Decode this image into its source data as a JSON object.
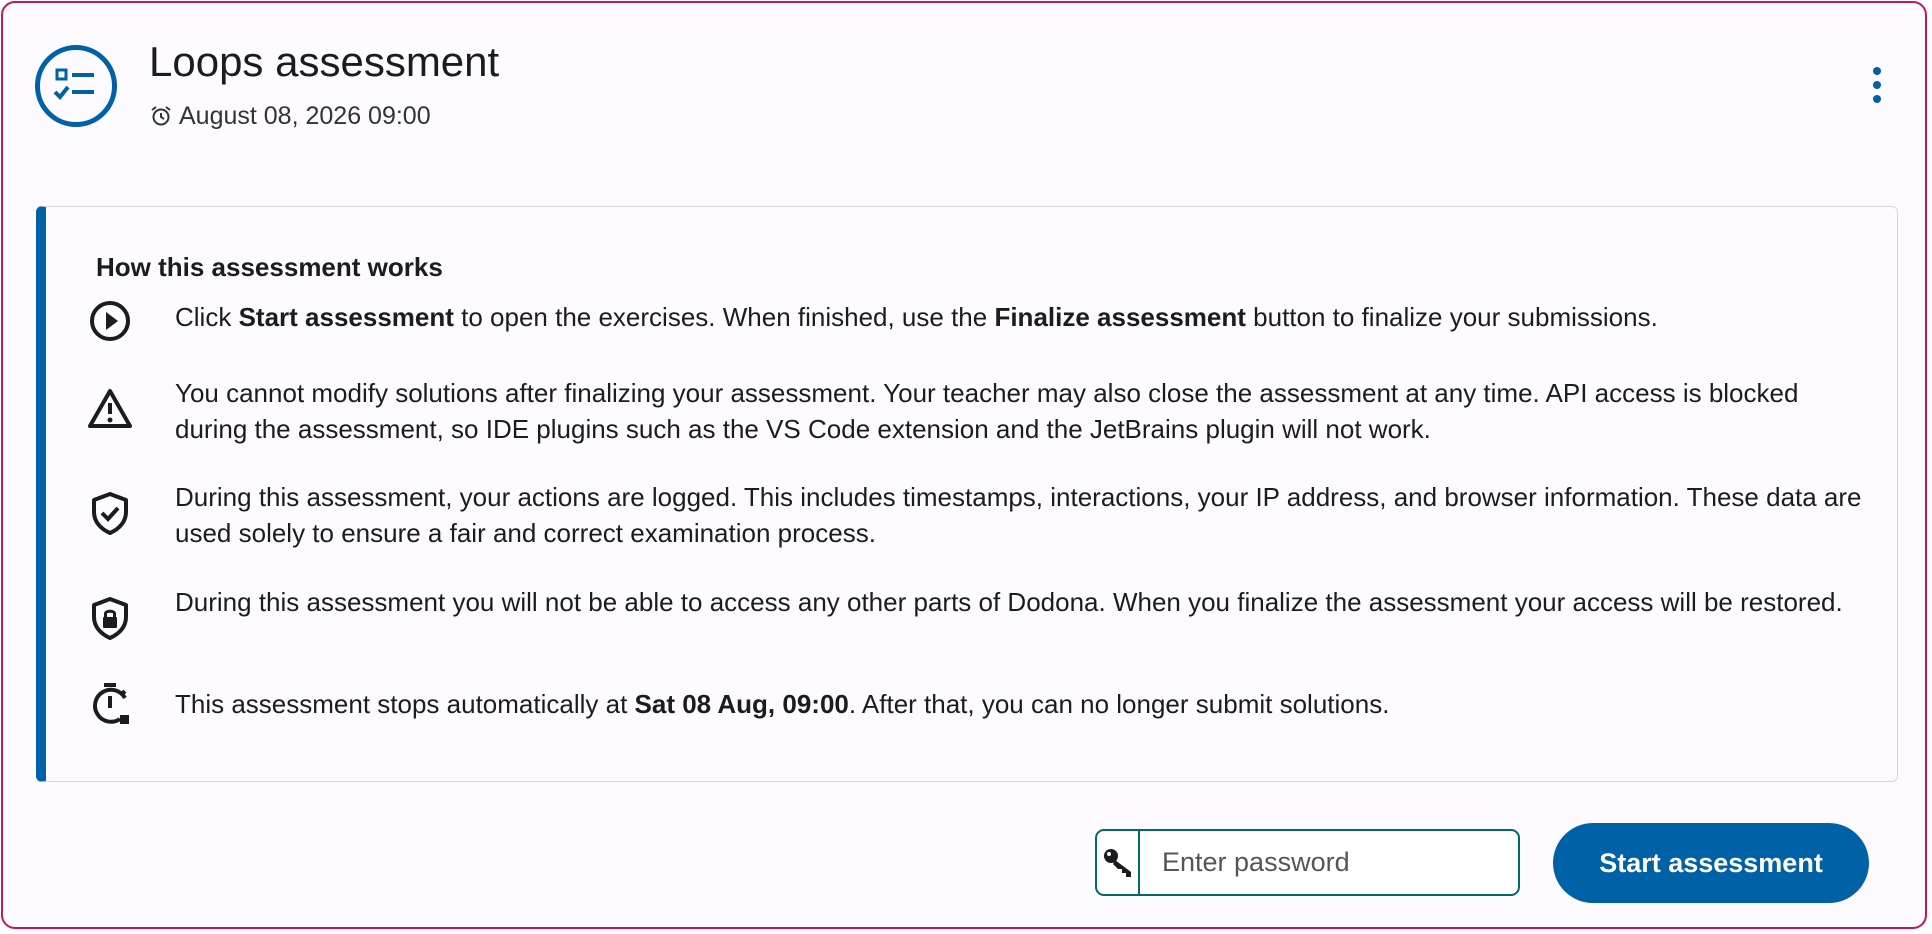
{
  "header": {
    "title": "Loops assessment",
    "deadline": "August 08, 2026 09:00",
    "icon": "checklist-icon"
  },
  "info": {
    "title": "How this assessment works",
    "rules": [
      {
        "icon": "play-circle-icon",
        "parts": [
          {
            "text": "Click ",
            "bold": false
          },
          {
            "text": "Start assessment",
            "bold": true
          },
          {
            "text": " to open the exercises. When finished, use the ",
            "bold": false
          },
          {
            "text": "Finalize assessment",
            "bold": true
          },
          {
            "text": " button to finalize your submissions.",
            "bold": false
          }
        ]
      },
      {
        "icon": "warning-icon",
        "parts": [
          {
            "text": "You cannot modify solutions after finalizing your assessment. Your teacher may also close the assessment at any time. API access is blocked during the assessment, so IDE plugins such as the VS Code extension and the JetBrains plugin will not work.",
            "bold": false
          }
        ]
      },
      {
        "icon": "shield-check-icon",
        "parts": [
          {
            "text": "During this assessment, your actions are logged. This includes timestamps, interactions, your IP address, and browser information. These data are used solely to ensure a fair and correct examination process.",
            "bold": false
          }
        ]
      },
      {
        "icon": "shield-lock-icon",
        "parts": [
          {
            "text": "During this assessment you will not be able to access any other parts of Dodona. When you finalize the assessment your access will be restored.",
            "bold": false
          }
        ]
      },
      {
        "icon": "timer-stop-icon",
        "parts": [
          {
            "text": "This assessment stops automatically at ",
            "bold": false
          },
          {
            "text": "Sat 08 Aug, 09:00",
            "bold": true
          },
          {
            "text": ". After that, you can no longer submit solutions.",
            "bold": false
          }
        ]
      }
    ]
  },
  "footer": {
    "password_placeholder": "Enter password",
    "password_value": "",
    "start_label": "Start assessment"
  },
  "colors": {
    "primary": "#0061a6",
    "card_border": "#c2185b",
    "input_border": "#006a6a"
  }
}
